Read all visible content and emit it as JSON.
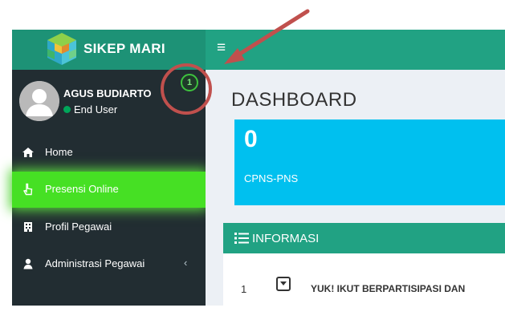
{
  "header": {
    "app_name": "SIKEP MARI",
    "menu_toggle": "≡"
  },
  "user": {
    "name": "AGUS BUDIARTO",
    "role": "End User",
    "notification_count": "1"
  },
  "sidebar": {
    "items": [
      {
        "label": "Home",
        "icon": "home-icon"
      },
      {
        "label": "Presensi Online",
        "icon": "hand-pointer-icon",
        "active": true
      },
      {
        "label": "Profil Pegawai",
        "icon": "building-icon"
      },
      {
        "label": "Administrasi Pegawai",
        "icon": "user-icon",
        "expand": "‹"
      }
    ]
  },
  "main": {
    "page_title": "DASHBOARD",
    "stat_box": {
      "value": "0",
      "label": "CPNS-PNS",
      "color": "#00c0ef"
    },
    "info_panel": {
      "title": "INFORMASI",
      "rows": [
        {
          "number": "1",
          "text": "YUK! IKUT BERPARTISIPASI DAN"
        }
      ]
    }
  },
  "colors": {
    "header": "#21a283",
    "sidebar": "#222d32",
    "active_item": "#46e024",
    "annotation": "#c0504d"
  }
}
